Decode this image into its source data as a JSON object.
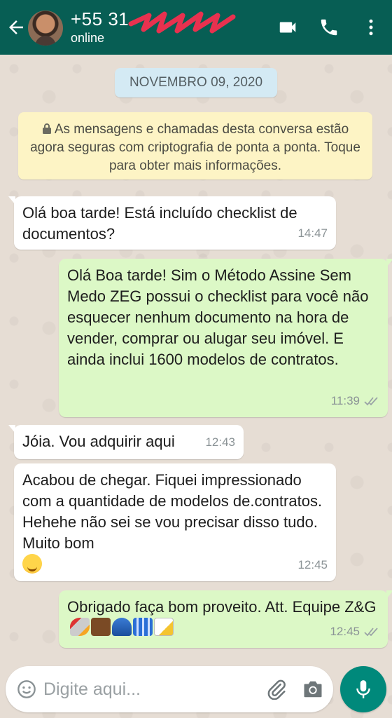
{
  "header": {
    "contact_name": "+55 31",
    "status": "online"
  },
  "chat": {
    "date_chip": "NOVEMBRO 09, 2020",
    "encryption_notice": "As mensagens e chamadas desta conversa estão agora seguras com criptografia de ponta a ponta. Toque para obter mais informações.",
    "messages": [
      {
        "direction": "incoming",
        "text": "Olá boa tarde! Está incluído checklist de documentos?",
        "time": "14:47"
      },
      {
        "direction": "outgoing",
        "text": "Olá Boa tarde! Sim o Método Assine Sem Medo ZEG possui o checklist para você não esquecer nenhum documento na hora de vender, comprar ou alugar seu imóvel. E ainda inclui 1600 modelos de contratos.",
        "time": "11:39",
        "status": "read-ticks"
      },
      {
        "direction": "incoming",
        "text": "Jóia. Vou adquirir aqui",
        "time": "12:43"
      },
      {
        "direction": "incoming",
        "text": "Acabou de chegar. Fiquei impressionado com a quantidade de modelos de.contratos. Hehehe não sei se vou precisar disso tudo. Muito bom",
        "emoji": "sweat-smile",
        "time": "12:45"
      },
      {
        "direction": "outgoing",
        "text": "Obrigado faça bom proveito. Att. Equipe Z&G",
        "emojis": [
          "rocket",
          "briefcase",
          "necktie",
          "bar-chart",
          "memo"
        ],
        "time": "12:45",
        "status": "read-ticks"
      }
    ]
  },
  "composer": {
    "placeholder": "Digite aqui..."
  },
  "colors": {
    "header": "#075e54",
    "incoming_bubble": "#ffffff",
    "outgoing_bubble": "#dcf8c6",
    "mic_button": "#00897b"
  }
}
